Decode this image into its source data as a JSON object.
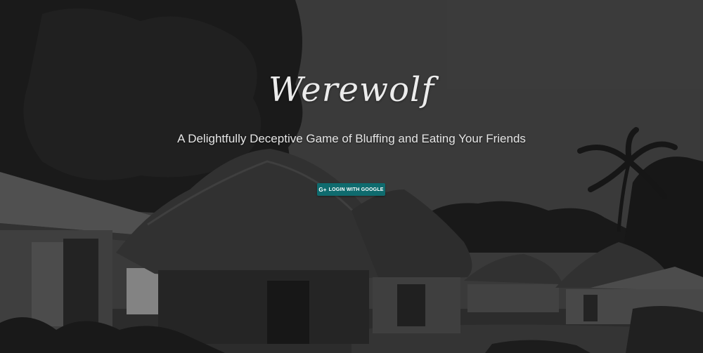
{
  "hero": {
    "title": "Werewolf",
    "subtitle": "A Delightfully Deceptive Game of Bluffing and Eating Your Friends"
  },
  "login": {
    "icon": "google-plus-icon",
    "icon_text": "G+",
    "label": "LOGIN WITH GOOGLE",
    "color": "#0f6b6e"
  }
}
